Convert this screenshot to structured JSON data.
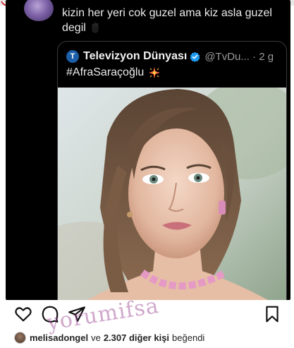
{
  "reply": {
    "text": "kizin her yeri cok guzel ama kiz asla guzel degil",
    "avatar_icon": "user-avatar"
  },
  "quoted_post": {
    "source_logo_letter": "T",
    "source_name": "Televizyon Dünyası",
    "verified_icon": "verified-badge-icon",
    "handle_time": "@TvDu... · 2 g",
    "hashtag": "#AfraSaraçoğlu",
    "emoji_icon": "sparkle-icon",
    "image_icon": "portrait-photo"
  },
  "actions": {
    "like_icon": "heart-icon",
    "comment_icon": "comment-icon",
    "share_icon": "send-icon",
    "save_icon": "bookmark-icon"
  },
  "likes": {
    "user": "melisadongel",
    "connector": "ve",
    "others": "2.307 diğer kişi",
    "verb": "beğendi"
  },
  "watermark": "yorumifsa",
  "colors": {
    "card_bg": "#000000",
    "text_light": "#eaeaea",
    "handle_gray": "#9a9a9a",
    "verified_blue": "#1d9bf0",
    "watermark": "#963c8c"
  }
}
